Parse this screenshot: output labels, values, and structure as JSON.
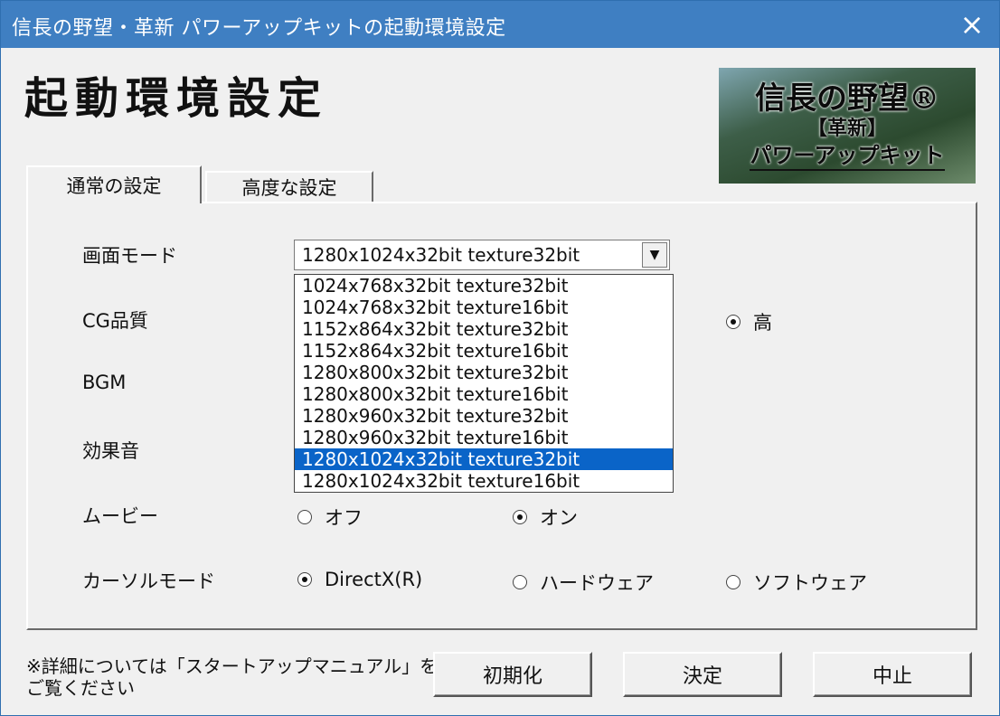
{
  "window": {
    "title": "信長の野望・革新 パワーアップキットの起動環境設定",
    "close_icon": "×"
  },
  "heading": "起動環境設定",
  "logo": {
    "line1": "信長の野望®",
    "line2": "【革新】",
    "line3": "パワーアップキット"
  },
  "tabs": [
    {
      "label": "通常の設定",
      "active": true
    },
    {
      "label": "高度な設定",
      "active": false
    }
  ],
  "settings": {
    "screen_mode": {
      "label": "画面モード",
      "value": "1280x1024x32bit texture32bit",
      "options": [
        "1024x768x32bit texture32bit",
        "1024x768x32bit texture16bit",
        "1152x864x32bit texture32bit",
        "1152x864x32bit texture16bit",
        "1280x800x32bit texture32bit",
        "1280x800x32bit texture16bit",
        "1280x960x32bit texture32bit",
        "1280x960x32bit texture16bit",
        "1280x1024x32bit texture32bit",
        "1280x1024x32bit texture16bit"
      ],
      "highlighted_index": 8
    },
    "cg_quality": {
      "label": "CG品質",
      "visible_option": "高",
      "selected": true
    },
    "bgm": {
      "label": "BGM"
    },
    "sound_effects": {
      "label": "効果音"
    },
    "movie": {
      "label": "ムービー",
      "options": [
        "オフ",
        "オン"
      ],
      "selected": "オン"
    },
    "cursor_mode": {
      "label": "カーソルモード",
      "options": [
        "DirectX(R)",
        "ハードウェア",
        "ソフトウェア"
      ],
      "selected": "DirectX(R)"
    }
  },
  "note": {
    "line1": "※詳細については「スタートアップマニュアル」を",
    "line2": "ご覧ください"
  },
  "buttons": {
    "reset": "初期化",
    "ok": "決定",
    "cancel": "中止"
  },
  "colors": {
    "titlebar": "#3f7fc2",
    "highlight": "#0a64c8"
  }
}
